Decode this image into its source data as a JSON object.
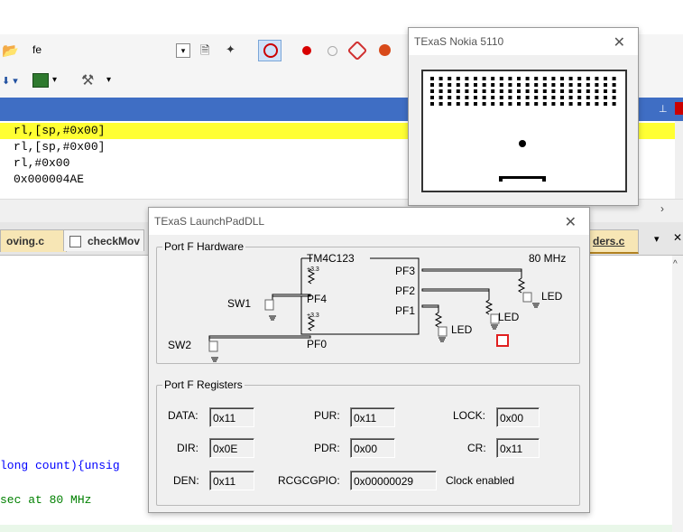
{
  "toolbar": {
    "find_text": "fe"
  },
  "disassembly": {
    "lines": [
      "rl,[sp,#0x00]",
      "rl,[sp,#0x00]",
      "rl,#0x00",
      "0x000004AE"
    ]
  },
  "tabs": [
    {
      "label": "oving.c"
    },
    {
      "label": "checkMov"
    },
    {
      "label": "ders.c"
    }
  ],
  "editor": {
    "lines": [
      "long count){unsig",
      "sec at 80 MHz"
    ]
  },
  "nokia": {
    "title": "TExaS Nokia 5110",
    "rows": 5,
    "cols": 22
  },
  "launchpad": {
    "title": "TExaS LaunchPadDLL",
    "hw_group": "Port F Hardware",
    "chip": "TM4C123",
    "clock": "80 MHz",
    "v33_a": "+3.3",
    "v33_b": "+3.3",
    "pins": {
      "pf3": "PF3",
      "pf2": "PF2",
      "pf1": "PF1",
      "pf4": "PF4",
      "pf0": "PF0"
    },
    "sw1": "SW1",
    "sw2": "SW2",
    "led_a": "LED",
    "led_b": "LED",
    "led_c": "LED",
    "reg_group": "Port F Registers",
    "registers": {
      "data_label": "DATA:",
      "data": "0x11",
      "dir_label": "DIR:",
      "dir": "0x0E",
      "den_label": "DEN:",
      "den": "0x11",
      "pur_label": "PUR:",
      "pur": "0x11",
      "pdr_label": "PDR:",
      "pdr": "0x00",
      "rcgc_label": "RCGCGPIO:",
      "rcgc": "0x00000029",
      "lock_label": "LOCK:",
      "lock": "0x00",
      "cr_label": "CR:",
      "cr": "0x11"
    },
    "clock_status": "Clock enabled"
  },
  "colors": {
    "highlight": "#ffff33",
    "comment": "#008000",
    "keyword": "#0000ff",
    "led_red": "#e02020"
  }
}
